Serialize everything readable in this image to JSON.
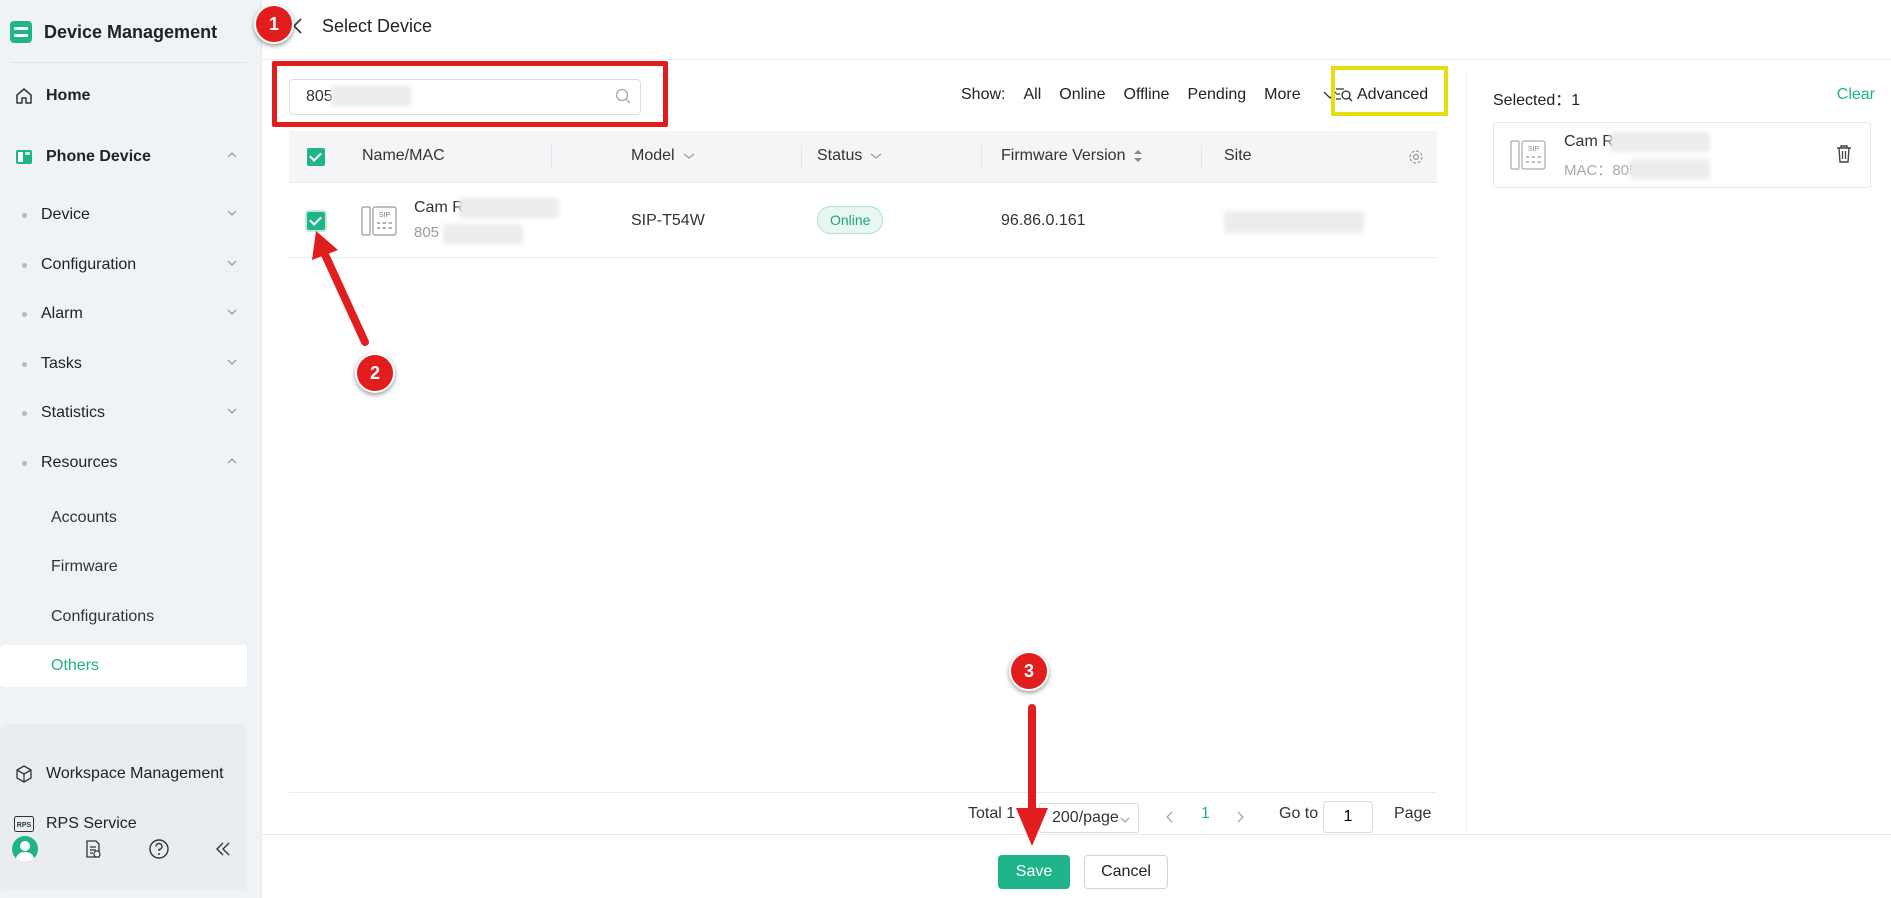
{
  "sidebar": {
    "brand": "Device Management",
    "home": "Home",
    "phone_device": "Phone Device",
    "groups": [
      "Device",
      "Configuration",
      "Alarm",
      "Tasks",
      "Statistics",
      "Resources"
    ],
    "resources": [
      "Accounts",
      "Firmware",
      "Configurations",
      "Others"
    ],
    "workspace": "Workspace Management",
    "rps": "RPS Service",
    "rps_icon_text": "RPS"
  },
  "header": {
    "title": "Select Device"
  },
  "search": {
    "value": "805"
  },
  "filters": {
    "label": "Show:",
    "options": [
      "All",
      "Online",
      "Offline",
      "Pending",
      "More"
    ],
    "advanced": "Advanced"
  },
  "table": {
    "columns": [
      "Name/MAC",
      "Model",
      "Status",
      "Firmware Version",
      "Site"
    ],
    "rows": [
      {
        "name": "Cam R",
        "mac": "805",
        "model": "SIP-T54W",
        "status": "Online",
        "firmware": "96.86.0.161"
      }
    ],
    "sip_icon_text": "SIP"
  },
  "pager": {
    "total": "Total 1",
    "size": "200/page",
    "page": "1",
    "goto": "Go to",
    "goto_value": "1",
    "page_label": "Page"
  },
  "selected": {
    "label": "Selected：",
    "count": "1",
    "clear": "Clear",
    "name": "Cam R",
    "mac_label": "MAC：",
    "mac": "805"
  },
  "footer": {
    "save": "Save",
    "cancel": "Cancel"
  },
  "annotations": [
    "1",
    "2",
    "3"
  ],
  "colors": {
    "accent": "#1fb489",
    "annotation_red": "#e11d1d",
    "highlight_yellow": "#e7dc10"
  }
}
